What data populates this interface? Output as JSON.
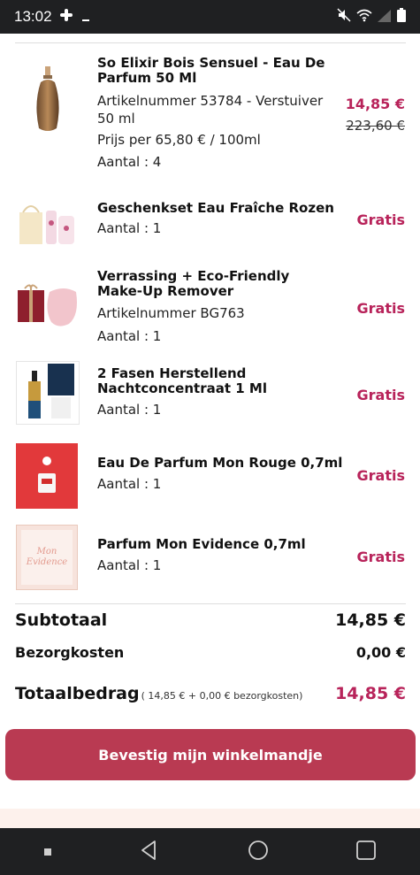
{
  "status_bar": {
    "time": "13:02"
  },
  "items": [
    {
      "name": "So Elixir Bois Sensuel - Eau De Parfum 50 Ml",
      "article": "Artikelnummer 53784 - Verstuiver 50 ml",
      "unit_price": "Prijs per 65,80 € / 100ml",
      "quantity": "Aantal : 4",
      "price": "14,85 €",
      "old_price": "223,60 €"
    },
    {
      "name": "Geschenkset Eau Fraîche Rozen",
      "quantity": "Aantal : 1",
      "price": "Gratis"
    },
    {
      "name": "Verrassing + Eco-Friendly Make-Up Remover",
      "article": "Artikelnummer BG763",
      "quantity": "Aantal : 1",
      "price": "Gratis"
    },
    {
      "name": "2 Fasen Herstellend Nachtconcentraat 1 Ml",
      "quantity": "Aantal : 1",
      "price": "Gratis"
    },
    {
      "name": "Eau De Parfum Mon Rouge 0,7ml",
      "quantity": "Aantal : 1",
      "price": "Gratis"
    },
    {
      "name": "Parfum Mon Evidence 0,7ml",
      "quantity": "Aantal : 1",
      "price": "Gratis",
      "thumb_text_1": "Mon",
      "thumb_text_2": "Evidence"
    }
  ],
  "summary": {
    "subtotal_label": "Subtotaal",
    "subtotal_value": "14,85 €",
    "shipping_label": "Bezorgkosten",
    "shipping_value": "0,00 €",
    "total_label": "Totaalbedrag",
    "total_note": "( 14,85 € + 0,00 € bezorgkosten)",
    "total_value": "14,85 €"
  },
  "cta_label": "Bevestig mijn winkelmandje",
  "colors": {
    "accent": "#b8235a",
    "button": "#b93a52",
    "system_bar": "#1f2022"
  }
}
